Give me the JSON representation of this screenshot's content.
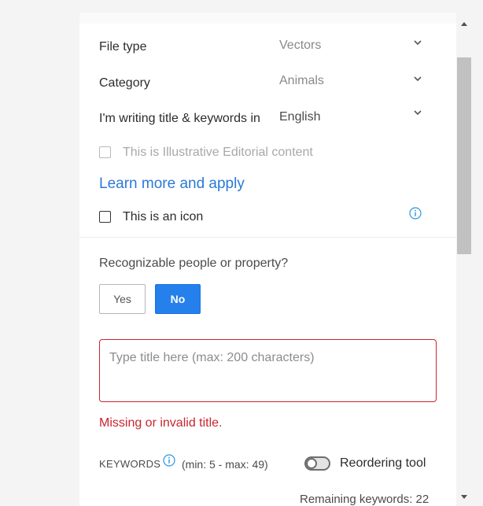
{
  "form": {
    "file_type": {
      "label": "File type",
      "value": "Vectors"
    },
    "category": {
      "label": "Category",
      "value": "Animals"
    },
    "language": {
      "label": "I'm writing title & keywords in",
      "value": "English"
    },
    "illustrative_editorial": {
      "label": "This is Illustrative Editorial content",
      "checked": false,
      "disabled": true
    },
    "learn_more_link": "Learn more and apply",
    "is_icon": {
      "label": "This is an icon",
      "checked": false
    },
    "recognizable": {
      "question": "Recognizable people or property?",
      "yes_label": "Yes",
      "no_label": "No",
      "selected": "No"
    },
    "title": {
      "placeholder": "Type title here (max: 200 characters)",
      "value": "",
      "error": "Missing or invalid title."
    },
    "keywords": {
      "label": "KEYWORDS",
      "range": "(min: 5 - max: 49)",
      "reordering_label": "Reordering tool",
      "reordering_on": false,
      "remaining": "Remaining keywords: 22"
    }
  },
  "icons": {
    "dropdown": "chevron-down-icon",
    "info": "info-icon",
    "scroll_up": "scroll-up-arrow-icon",
    "scroll_down": "scroll-down-arrow-icon"
  },
  "colors": {
    "accent": "#2680eb",
    "link": "#2a7ad6",
    "error": "#c9252d",
    "info_icon": "#2c96e0"
  }
}
